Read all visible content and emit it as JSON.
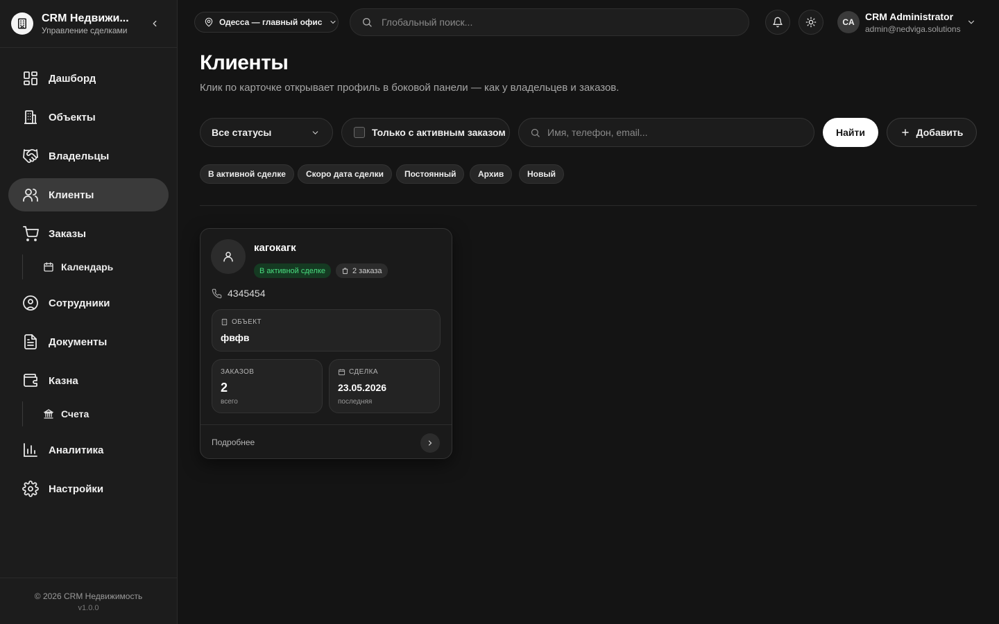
{
  "brand": {
    "title": "CRM Недвижи...",
    "subtitle": "Управление сделками"
  },
  "sidebar": {
    "items": [
      {
        "label": "Дашборд",
        "icon": "dashboard-icon"
      },
      {
        "label": "Объекты",
        "icon": "building-icon"
      },
      {
        "label": "Владельцы",
        "icon": "handshake-icon"
      },
      {
        "label": "Клиенты",
        "icon": "users-icon",
        "active": true
      },
      {
        "label": "Заказы",
        "icon": "cart-icon"
      },
      {
        "label": "Сотрудники",
        "icon": "user-circle-icon"
      },
      {
        "label": "Документы",
        "icon": "document-icon"
      },
      {
        "label": "Казна",
        "icon": "wallet-icon"
      },
      {
        "label": "Аналитика",
        "icon": "chart-icon"
      },
      {
        "label": "Настройки",
        "icon": "gear-icon"
      }
    ],
    "subitems": {
      "calendar": "Календарь",
      "accounts": "Счета"
    },
    "footer": {
      "copyright": "© 2026 CRM Недвижимость",
      "version": "v1.0.0"
    }
  },
  "topbar": {
    "office": "Одесса — главный офис",
    "search_placeholder": "Глобальный поиск...",
    "user": {
      "initials": "CA",
      "name": "CRM Administrator",
      "email": "admin@nedviga.solutions"
    }
  },
  "main": {
    "title": "Клиенты",
    "subtitle": "Клик по карточке открывает профиль в боковой панели — как у владельцев и заказов.",
    "filters": {
      "status_select": "Все статусы",
      "active_only": "Только с активным заказом",
      "search_placeholder": "Имя, телефон, email...",
      "find_label": "Найти",
      "add_label": "Добавить"
    },
    "chips": [
      "В активной сделке",
      "Скоро дата сделки",
      "Постоянный",
      "Архив",
      "Новый"
    ]
  },
  "card": {
    "name": "кагокагк",
    "status": "В активной сделке",
    "orders_badge": "2 заказа",
    "phone": "4345454",
    "object_label": "ОБЪЕКТ",
    "object_value": "фвфв",
    "orders_label": "ЗАКАЗОВ",
    "orders_value": "2",
    "orders_hint": "всего",
    "deal_label": "СДЕЛКА",
    "deal_value": "23.05.2026",
    "deal_hint": "последняя",
    "more": "Подробнее"
  },
  "colors": {
    "background": "#141414",
    "sidebar": "#1c1c1c",
    "active_nav": "#3a3a3a",
    "status_green": "#4ade80",
    "primary_button": "#ffffff"
  }
}
